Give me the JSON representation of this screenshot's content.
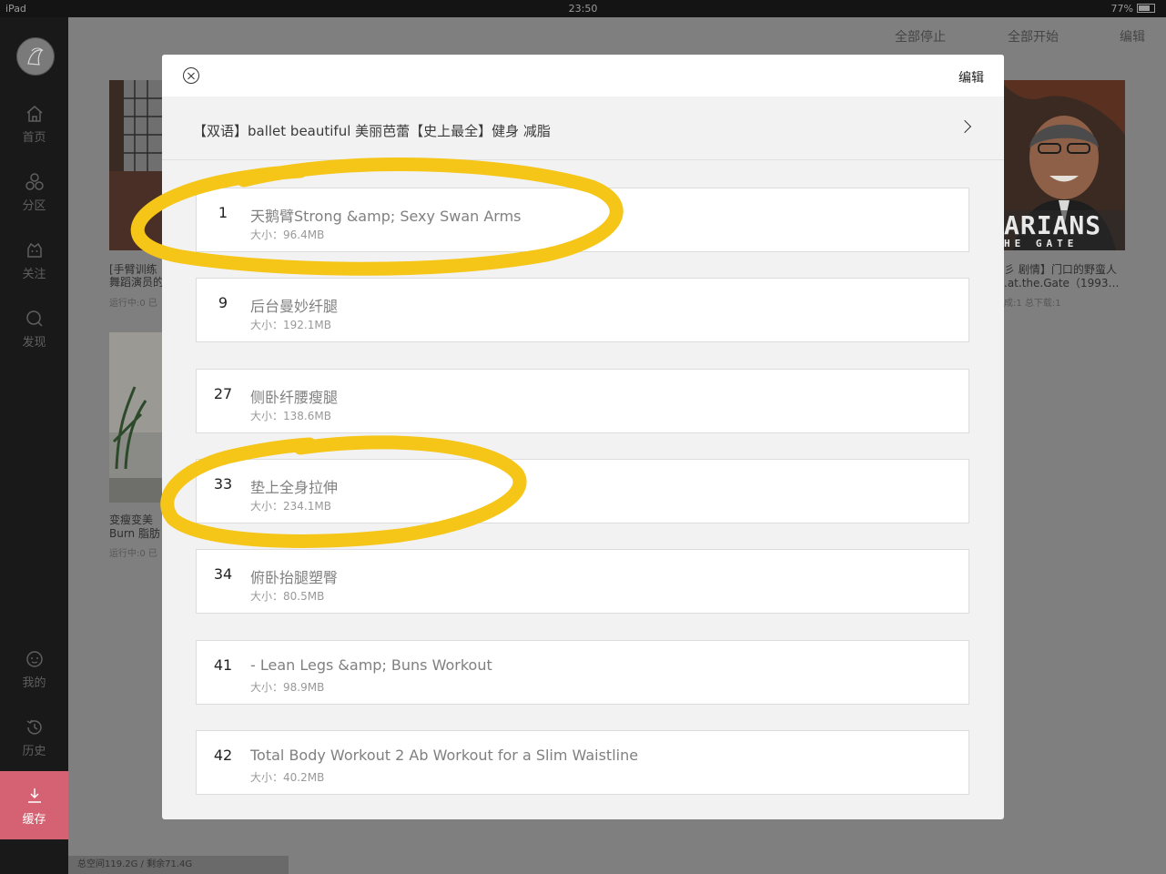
{
  "status_bar": {
    "device": "iPad",
    "time": "23:50",
    "battery": "77%"
  },
  "sidebar": {
    "items": [
      {
        "label": "首页",
        "icon": "home-icon"
      },
      {
        "label": "分区",
        "icon": "category-icon"
      },
      {
        "label": "关注",
        "icon": "follow-icon"
      },
      {
        "label": "发现",
        "icon": "search-icon"
      },
      {
        "label": "我的",
        "icon": "profile-icon"
      },
      {
        "label": "历史",
        "icon": "history-icon"
      },
      {
        "label": "缓存",
        "icon": "download-icon",
        "active": true
      }
    ]
  },
  "header": {
    "stop_all": "全部停止",
    "start_all": "全部开始",
    "edit": "编辑"
  },
  "background": {
    "cards": [
      {
        "title_line1": "[手臂训练",
        "title_line2": "舞蹈演员的",
        "meta": "运行中:0 已"
      },
      {
        "title_line1": "变瘦变美",
        "title_line2": "Burn 脂肪",
        "meta": "运行中:0 已"
      },
      {
        "title_line1": "彡 剧情】门口的野蛮人",
        "title_line2": ".at.the.Gate（1993…",
        "meta": "成:1 总下载:1"
      }
    ],
    "poster_text": {
      "line1": "ARIANS",
      "line2": "HE GATE"
    },
    "storage": "总空间119.2G / 剩余71.4G"
  },
  "modal": {
    "edit": "编辑",
    "series_title": "【双语】ballet beautiful 美丽芭蕾【史上最全】健身 减脂",
    "episodes": [
      {
        "num": "1",
        "title": "天鹅臂Strong &amp; Sexy Swan Arms",
        "size": "大小：96.4MB",
        "highlighted": true
      },
      {
        "num": "9",
        "title": "后台曼妙纤腿",
        "size": "大小：192.1MB"
      },
      {
        "num": "27",
        "title": "侧卧纤腰瘦腿",
        "size": "大小：138.6MB"
      },
      {
        "num": "33",
        "title": "垫上全身拉伸",
        "size": "大小：234.1MB",
        "highlighted": true
      },
      {
        "num": "34",
        "title": "俯卧抬腿塑臀",
        "size": "大小：80.5MB"
      },
      {
        "num": "41",
        "title": "- Lean Legs &amp; Buns Workout",
        "size": "大小：98.9MB"
      },
      {
        "num": "42",
        "title": "Total Body Workout 2 Ab Workout for a Slim Waistline",
        "size": "大小：40.2MB"
      }
    ]
  },
  "colors": {
    "accent": "#d46272",
    "highlight": "#f5c518",
    "overlay": "#7f7f7f"
  }
}
